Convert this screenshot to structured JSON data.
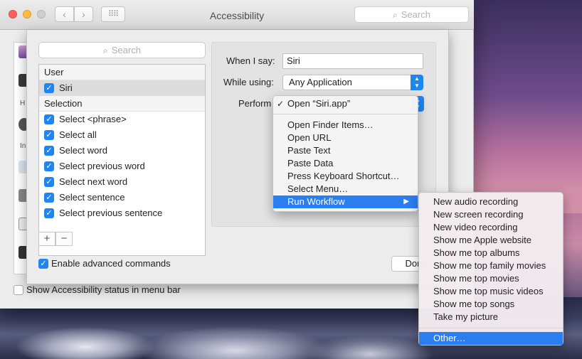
{
  "window": {
    "title": "Accessibility",
    "search_placeholder": "Search",
    "nav_back": "‹",
    "nav_forward": "›",
    "grid": "⠿⠿",
    "category_letters": [
      "H",
      "In"
    ],
    "status_bar_label": "Show Accessibility status in menu bar"
  },
  "sheet": {
    "search_placeholder": "Search",
    "list": [
      {
        "type": "header",
        "label": "User"
      },
      {
        "type": "item",
        "label": "Siri",
        "checked": true,
        "selected": true
      },
      {
        "type": "header",
        "label": "Selection"
      },
      {
        "type": "item",
        "label": "Select <phrase>",
        "checked": true
      },
      {
        "type": "item",
        "label": "Select all",
        "checked": true
      },
      {
        "type": "item",
        "label": "Select word",
        "checked": true
      },
      {
        "type": "item",
        "label": "Select previous word",
        "checked": true
      },
      {
        "type": "item",
        "label": "Select next word",
        "checked": true
      },
      {
        "type": "item",
        "label": "Select sentence",
        "checked": true
      },
      {
        "type": "item",
        "label": "Select previous sentence",
        "checked": true
      }
    ],
    "plus": "+",
    "minus": "−",
    "advanced_label": "Enable advanced commands",
    "when_label": "When I say:",
    "when_value": "Siri",
    "while_label": "While using:",
    "while_value": "Any Application",
    "perform_label": "Perform",
    "done_label": "Done"
  },
  "menu": {
    "checked_label": "Open “Siri.app”",
    "items": [
      "Open Finder Items…",
      "Open URL",
      "Paste Text",
      "Paste Data",
      "Press Keyboard Shortcut…",
      "Select Menu…"
    ],
    "highlighted": "Run Workflow"
  },
  "submenu": {
    "items": [
      "New audio recording",
      "New screen recording",
      "New video recording",
      "Show me Apple website",
      "Show me top albums",
      "Show me top family movies",
      "Show me top movies",
      "Show me top music videos",
      "Show me top songs",
      "Take my picture"
    ],
    "other": "Other…"
  },
  "colors": {
    "accent": "#1f86f1",
    "highlight": "#2a7ef0"
  }
}
